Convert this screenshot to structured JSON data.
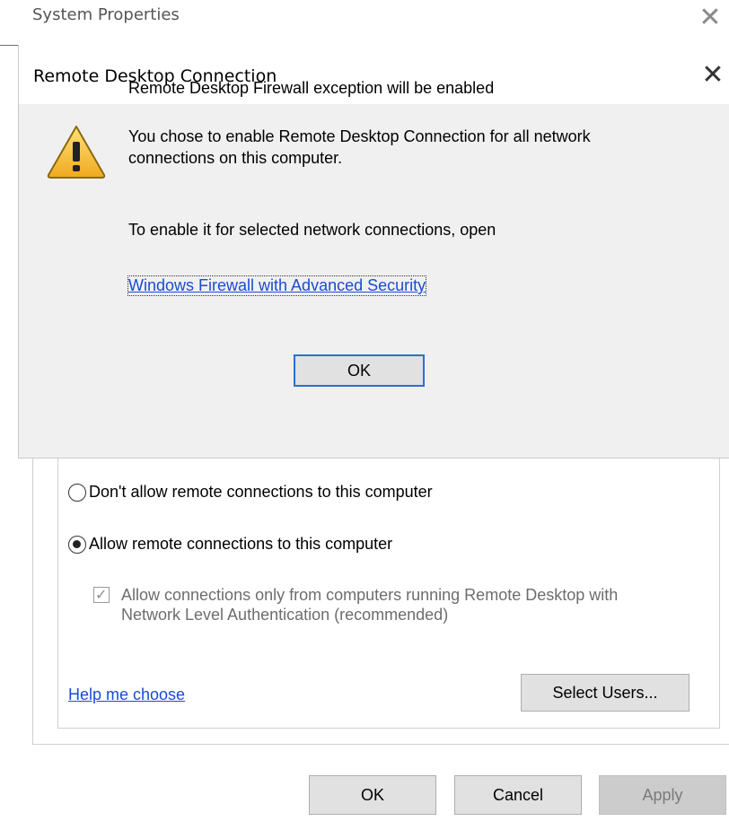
{
  "system_properties": {
    "title": "System Properties",
    "close_icon": "close-icon"
  },
  "rdc_dialog": {
    "title": "Remote Desktop Connection",
    "icon": "warning-icon",
    "heading": "Remote Desktop Firewall exception will be enabled",
    "body": "You chose to enable Remote Desktop Connection for all network connections on this computer.",
    "instruction": "To enable it for selected network connections, open",
    "firewall_link": "Windows Firewall with Advanced Security",
    "ok_label": "OK",
    "accent_color": "#2c70cf"
  },
  "remote_desktop": {
    "option_disallow": "Don't allow remote connections to this computer",
    "option_allow": "Allow remote connections to this computer",
    "selected_option": "allow",
    "nla_label": "Allow connections only from computers running Remote Desktop with Network Level Authentication (recommended)",
    "nla_checked": true,
    "nla_disabled": true,
    "help_link": "Help me choose",
    "select_users_label": "Select Users..."
  },
  "bottom_buttons": {
    "ok": "OK",
    "cancel": "Cancel",
    "apply": "Apply"
  },
  "colors": {
    "link": "#1a4bd6",
    "dialog_background": "#f0f0f0",
    "button_background": "#e1e1e1"
  }
}
